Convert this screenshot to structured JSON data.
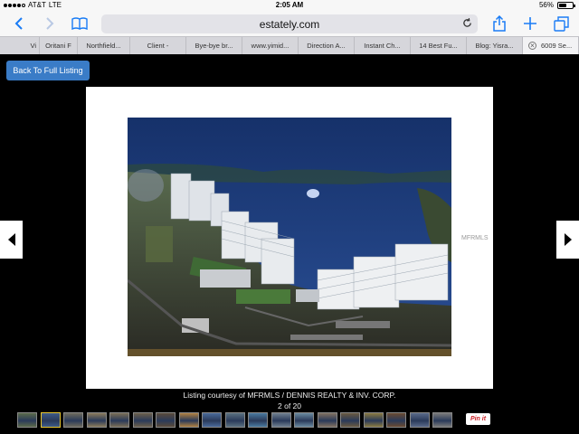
{
  "status_bar": {
    "carrier": "AT&T",
    "network": "LTE",
    "time": "2:05 AM",
    "battery": "56%",
    "battery_level": 0.56
  },
  "nav": {
    "url": "estately.com"
  },
  "tabs": [
    {
      "label": "Vi"
    },
    {
      "label": "Oritani F"
    },
    {
      "label": "Northfield..."
    },
    {
      "label": "Client -"
    },
    {
      "label": "Bye-bye br..."
    },
    {
      "label": "www.yimid..."
    },
    {
      "label": "Direction A..."
    },
    {
      "label": "Instant Ch..."
    },
    {
      "label": "14 Best Fu..."
    },
    {
      "label": "Blog: Yisra..."
    },
    {
      "label": "6009 Se..."
    }
  ],
  "back_button": {
    "label": "Back To Full Listing"
  },
  "photo": {
    "watermark": "MFRMLS"
  },
  "caption": {
    "courtesy": "Listing courtesy of MFRMLS / DENNIS REALTY & INV. CORP.",
    "counter": "2 of 20"
  },
  "thumbnails": {
    "count": 19,
    "active_index": 1,
    "colors": [
      "#5b6a4a",
      "#3d5a88",
      "#6d6a5c",
      "#8a7a5a",
      "#7a6d55",
      "#6b5f4a",
      "#5a4a3a",
      "#b08040",
      "#4a6a9a",
      "#5a7080",
      "#4a7aa0",
      "#708090",
      "#6a8aa0",
      "#807060",
      "#6a5a40",
      "#8a7a40",
      "#6a4a30",
      "#5a6a8a",
      "#7a7a7a"
    ]
  },
  "pin_button": {
    "label": "Pin it"
  },
  "colors": {
    "accent": "#1a7cf5",
    "back_button": "#3a7cc7",
    "active_thumb": "#e8c630"
  }
}
